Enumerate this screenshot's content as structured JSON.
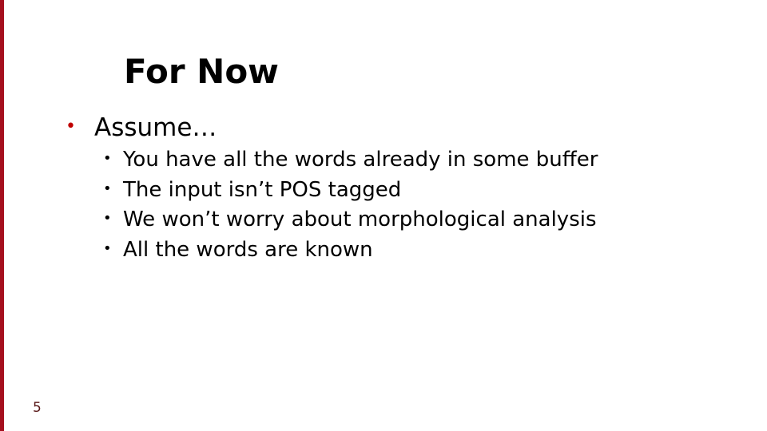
{
  "slide": {
    "title": "For Now",
    "accent_color": "#a50f1e",
    "bullets": [
      {
        "text": "Assume…",
        "sub_items": [
          "You have all the words already in some buffer",
          "The input isn’t POS tagged",
          "We won’t worry about morphological analysis",
          "All the words are known"
        ]
      }
    ],
    "bullet_glyph": "•",
    "page_number": "5"
  }
}
